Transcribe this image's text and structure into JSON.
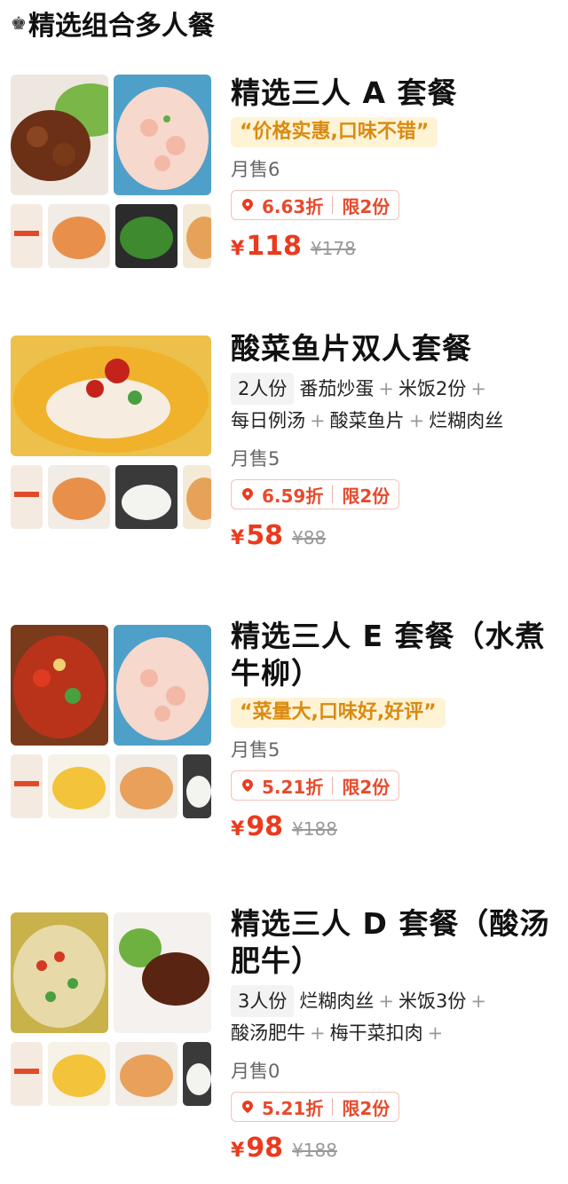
{
  "section": {
    "icon": "crown-icon",
    "title": "精选组合多人餐"
  },
  "accent": "#ea3b1e",
  "cards": [
    {
      "name": "精选三人 A 套餐",
      "slogan": "“价格实惠,口味不错”",
      "sales": "月售6",
      "discount": "6.63折",
      "limit": "限2份",
      "price": "118",
      "old_price": "¥178"
    },
    {
      "name": "酸菜鱼片双人套餐",
      "people": "2人份",
      "combo_line1": [
        "番茄炒蛋",
        "米饭2份"
      ],
      "combo_line2": [
        "每日例汤",
        "酸菜鱼片",
        "烂糊肉丝"
      ],
      "sales": "月售5",
      "discount": "6.59折",
      "limit": "限2份",
      "price": "58",
      "old_price": "¥88"
    },
    {
      "name": "精选三人 E 套餐（水煮牛柳）",
      "slogan": "“菜量大,口味好,好评”",
      "sales": "月售5",
      "discount": "5.21折",
      "limit": "限2份",
      "price": "98",
      "old_price": "¥188"
    },
    {
      "name": "精选三人 D 套餐（酸汤肥牛）",
      "people": "3人份",
      "combo_line1": [
        "烂糊肉丝",
        "米饭3份"
      ],
      "combo_line2": [
        "酸汤肥牛",
        "梅干菜扣肉"
      ],
      "sales": "月售0",
      "discount": "5.21折",
      "limit": "限2份",
      "price": "98",
      "old_price": "¥188"
    }
  ],
  "currency": "¥"
}
